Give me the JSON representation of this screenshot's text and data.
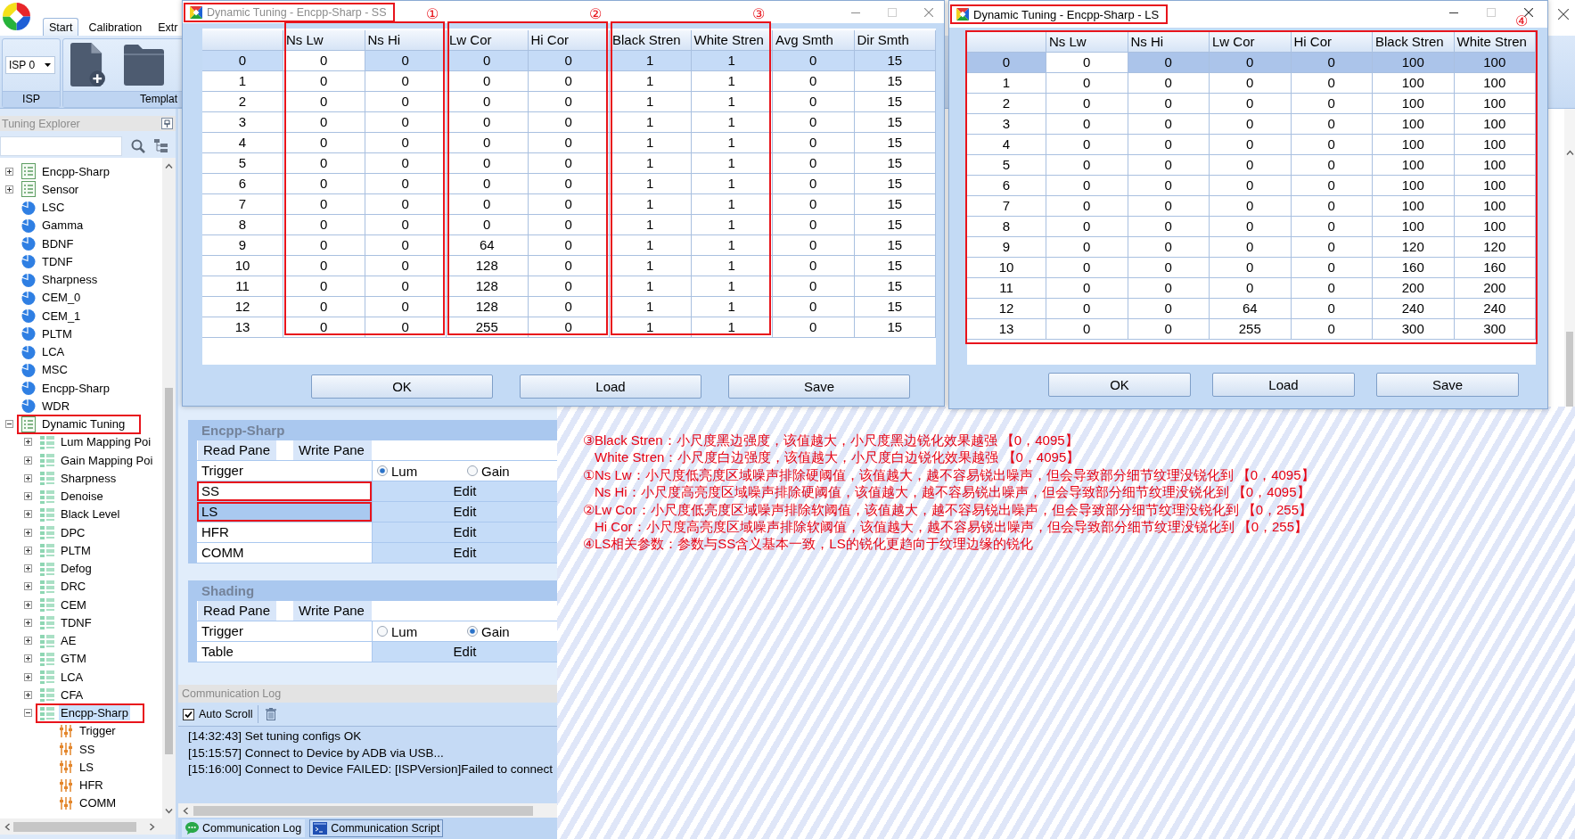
{
  "ribbon": {
    "tabs": [
      {
        "label": "Start",
        "selected": true
      },
      {
        "label": "Calibration",
        "selected": false
      },
      {
        "label": "Extr",
        "selected": false
      }
    ],
    "groups": [
      {
        "kind": "combo",
        "label": "ISP",
        "value": "ISP 0"
      },
      {
        "kind": "templates",
        "label": "Templat"
      }
    ]
  },
  "explorer": {
    "title": "Tuning Explorer",
    "tree": [
      {
        "label": "Encpp-Sharp",
        "kind": "list",
        "expanded": false,
        "selected": false,
        "outlined": false
      },
      {
        "label": "Sensor",
        "kind": "list",
        "expanded": false,
        "selected": false,
        "outlined": false
      },
      {
        "label": "LSC",
        "kind": "module",
        "selected": false,
        "outlined": false
      },
      {
        "label": "Gamma",
        "kind": "module",
        "selected": false,
        "outlined": false
      },
      {
        "label": "BDNF",
        "kind": "module",
        "selected": false,
        "outlined": false
      },
      {
        "label": "TDNF",
        "kind": "module",
        "selected": false,
        "outlined": false
      },
      {
        "label": "Sharpness",
        "kind": "module",
        "selected": false,
        "outlined": false
      },
      {
        "label": "CEM_0",
        "kind": "module",
        "selected": false,
        "outlined": false
      },
      {
        "label": "CEM_1",
        "kind": "module",
        "selected": false,
        "outlined": false
      },
      {
        "label": "PLTM",
        "kind": "module",
        "selected": false,
        "outlined": false
      },
      {
        "label": "LCA",
        "kind": "module",
        "selected": false,
        "outlined": false
      },
      {
        "label": "MSC",
        "kind": "module",
        "selected": false,
        "outlined": false
      },
      {
        "label": "Encpp-Sharp",
        "kind": "module",
        "selected": false,
        "outlined": false
      },
      {
        "label": "WDR",
        "kind": "module",
        "selected": false,
        "outlined": false
      },
      {
        "label": "Dynamic Tuning",
        "kind": "list",
        "expanded": true,
        "selected": false,
        "outlined": true,
        "children": [
          {
            "label": "Lum Mapping Poi",
            "kind": "group",
            "expanded": false,
            "selected": false,
            "outlined": false
          },
          {
            "label": "Gain Mapping Poi",
            "kind": "group",
            "expanded": false,
            "selected": false,
            "outlined": false
          },
          {
            "label": "Sharpness",
            "kind": "group",
            "expanded": false,
            "selected": false,
            "outlined": false
          },
          {
            "label": "Denoise",
            "kind": "group",
            "expanded": false,
            "selected": false,
            "outlined": false
          },
          {
            "label": "Black Level",
            "kind": "group",
            "expanded": false,
            "selected": false,
            "outlined": false
          },
          {
            "label": "DPC",
            "kind": "group",
            "expanded": false,
            "selected": false,
            "outlined": false
          },
          {
            "label": "PLTM",
            "kind": "group",
            "expanded": false,
            "selected": false,
            "outlined": false
          },
          {
            "label": "Defog",
            "kind": "group",
            "expanded": false,
            "selected": false,
            "outlined": false
          },
          {
            "label": "DRC",
            "kind": "group",
            "expanded": false,
            "selected": false,
            "outlined": false
          },
          {
            "label": "CEM",
            "kind": "group",
            "expanded": false,
            "selected": false,
            "outlined": false
          },
          {
            "label": "TDNF",
            "kind": "group",
            "expanded": false,
            "selected": false,
            "outlined": false
          },
          {
            "label": "AE",
            "kind": "group",
            "expanded": false,
            "selected": false,
            "outlined": false
          },
          {
            "label": "GTM",
            "kind": "group",
            "expanded": false,
            "selected": false,
            "outlined": false
          },
          {
            "label": "LCA",
            "kind": "group",
            "expanded": false,
            "selected": false,
            "outlined": false
          },
          {
            "label": "CFA",
            "kind": "group",
            "expanded": false,
            "selected": false,
            "outlined": false
          },
          {
            "label": "Encpp-Sharp",
            "kind": "group",
            "expanded": true,
            "selected": true,
            "outlined": true,
            "children": [
              {
                "label": "Trigger",
                "kind": "param",
                "selected": false,
                "outlined": false
              },
              {
                "label": "SS",
                "kind": "param",
                "selected": false,
                "outlined": false
              },
              {
                "label": "LS",
                "kind": "param",
                "selected": false,
                "outlined": false
              },
              {
                "label": "HFR",
                "kind": "param",
                "selected": false,
                "outlined": false
              },
              {
                "label": "COMM",
                "kind": "param",
                "selected": false,
                "outlined": false
              }
            ]
          }
        ]
      }
    ]
  },
  "dialogs": [
    {
      "title": "Dynamic Tuning - Encpp-Sharp - SS",
      "active": false,
      "title_outlined": true,
      "column_groups": [
        {
          "callout": "①",
          "outlined": true,
          "columns": [
            "Ns Lw",
            "Ns Hi"
          ]
        },
        {
          "callout": "②",
          "outlined": true,
          "columns": [
            "Lw Cor",
            "Hi Cor"
          ]
        },
        {
          "callout": "③",
          "outlined": true,
          "columns": [
            "Black Stren",
            "White Stren"
          ]
        },
        {
          "outlined": false,
          "columns": [
            "Avg Smth",
            "Dir Smth"
          ]
        }
      ],
      "rows": [
        {
          "header": "0",
          "selected": true,
          "current": [
            true,
            false,
            false,
            false,
            false,
            false,
            false,
            false
          ],
          "cells": [
            "0",
            "0",
            "0",
            "0",
            "1",
            "1",
            "0",
            "15"
          ]
        },
        {
          "header": "1",
          "selected": false,
          "cells": [
            "0",
            "0",
            "0",
            "0",
            "1",
            "1",
            "0",
            "15"
          ]
        },
        {
          "header": "2",
          "selected": false,
          "cells": [
            "0",
            "0",
            "0",
            "0",
            "1",
            "1",
            "0",
            "15"
          ]
        },
        {
          "header": "3",
          "selected": false,
          "cells": [
            "0",
            "0",
            "0",
            "0",
            "1",
            "1",
            "0",
            "15"
          ]
        },
        {
          "header": "4",
          "selected": false,
          "cells": [
            "0",
            "0",
            "0",
            "0",
            "1",
            "1",
            "0",
            "15"
          ]
        },
        {
          "header": "5",
          "selected": false,
          "cells": [
            "0",
            "0",
            "0",
            "0",
            "1",
            "1",
            "0",
            "15"
          ]
        },
        {
          "header": "6",
          "selected": false,
          "cells": [
            "0",
            "0",
            "0",
            "0",
            "1",
            "1",
            "0",
            "15"
          ]
        },
        {
          "header": "7",
          "selected": false,
          "cells": [
            "0",
            "0",
            "0",
            "0",
            "1",
            "1",
            "0",
            "15"
          ]
        },
        {
          "header": "8",
          "selected": false,
          "cells": [
            "0",
            "0",
            "0",
            "0",
            "1",
            "1",
            "0",
            "15"
          ]
        },
        {
          "header": "9",
          "selected": false,
          "cells": [
            "0",
            "0",
            "64",
            "0",
            "1",
            "1",
            "0",
            "15"
          ]
        },
        {
          "header": "10",
          "selected": false,
          "cells": [
            "0",
            "0",
            "128",
            "0",
            "1",
            "1",
            "0",
            "15"
          ]
        },
        {
          "header": "11",
          "selected": false,
          "cells": [
            "0",
            "0",
            "128",
            "0",
            "1",
            "1",
            "0",
            "15"
          ]
        },
        {
          "header": "12",
          "selected": false,
          "cells": [
            "0",
            "0",
            "128",
            "0",
            "1",
            "1",
            "0",
            "15"
          ]
        },
        {
          "header": "13",
          "selected": false,
          "cells": [
            "0",
            "0",
            "255",
            "0",
            "1",
            "1",
            "0",
            "15"
          ]
        }
      ],
      "buttons": [
        "OK",
        "Load",
        "Save"
      ]
    },
    {
      "title": "Dynamic Tuning - Encpp-Sharp - LS",
      "active": true,
      "title_outlined": true,
      "table_outlined": true,
      "table_callout": "④",
      "column_groups": [
        {
          "outlined": false,
          "columns": [
            "Ns Lw",
            "Ns Hi",
            "Lw Cor",
            "Hi Cor",
            "Black Stren",
            "White Stren"
          ]
        }
      ],
      "rows": [
        {
          "header": "0",
          "selected": true,
          "current": [
            true,
            false,
            false,
            false,
            false,
            false
          ],
          "cells": [
            "0",
            "0",
            "0",
            "0",
            "100",
            "100"
          ]
        },
        {
          "header": "1",
          "selected": false,
          "cells": [
            "0",
            "0",
            "0",
            "0",
            "100",
            "100"
          ]
        },
        {
          "header": "2",
          "selected": false,
          "cells": [
            "0",
            "0",
            "0",
            "0",
            "100",
            "100"
          ]
        },
        {
          "header": "3",
          "selected": false,
          "cells": [
            "0",
            "0",
            "0",
            "0",
            "100",
            "100"
          ]
        },
        {
          "header": "4",
          "selected": false,
          "cells": [
            "0",
            "0",
            "0",
            "0",
            "100",
            "100"
          ]
        },
        {
          "header": "5",
          "selected": false,
          "cells": [
            "0",
            "0",
            "0",
            "0",
            "100",
            "100"
          ]
        },
        {
          "header": "6",
          "selected": false,
          "cells": [
            "0",
            "0",
            "0",
            "0",
            "100",
            "100"
          ]
        },
        {
          "header": "7",
          "selected": false,
          "cells": [
            "0",
            "0",
            "0",
            "0",
            "100",
            "100"
          ]
        },
        {
          "header": "8",
          "selected": false,
          "cells": [
            "0",
            "0",
            "0",
            "0",
            "100",
            "100"
          ]
        },
        {
          "header": "9",
          "selected": false,
          "cells": [
            "0",
            "0",
            "0",
            "0",
            "120",
            "120"
          ]
        },
        {
          "header": "10",
          "selected": false,
          "cells": [
            "0",
            "0",
            "0",
            "0",
            "160",
            "160"
          ]
        },
        {
          "header": "11",
          "selected": false,
          "cells": [
            "0",
            "0",
            "0",
            "0",
            "200",
            "200"
          ]
        },
        {
          "header": "12",
          "selected": false,
          "cells": [
            "0",
            "0",
            "64",
            "0",
            "240",
            "240"
          ]
        },
        {
          "header": "13",
          "selected": false,
          "cells": [
            "0",
            "0",
            "255",
            "0",
            "300",
            "300"
          ]
        }
      ],
      "buttons": [
        "OK",
        "Load",
        "Save"
      ]
    }
  ],
  "property_groups": [
    {
      "title": "Encpp-Sharp",
      "panes": [
        "Read Pane",
        "Write Pane"
      ],
      "rows": [
        {
          "label": "Trigger",
          "kind": "radio",
          "selected": false,
          "outlined": false,
          "options": [
            {
              "label": "Lum",
              "selected": true
            },
            {
              "label": "Gain",
              "selected": false
            }
          ]
        },
        {
          "label": "SS",
          "kind": "edit",
          "button": "Edit",
          "selected": false,
          "outlined": true
        },
        {
          "label": "LS",
          "kind": "edit",
          "button": "Edit",
          "selected": true,
          "outlined": true
        },
        {
          "label": "HFR",
          "kind": "edit",
          "button": "Edit",
          "selected": false,
          "outlined": false
        },
        {
          "label": "COMM",
          "kind": "edit",
          "button": "Edit",
          "selected": false,
          "outlined": false
        }
      ]
    },
    {
      "title": "Shading",
      "panes": [
        "Read Pane",
        "Write Pane"
      ],
      "rows": [
        {
          "label": "Trigger",
          "kind": "radio",
          "selected": false,
          "outlined": false,
          "options": [
            {
              "label": "Lum",
              "selected": false
            },
            {
              "label": "Gain",
              "selected": true
            }
          ]
        },
        {
          "label": "Table",
          "kind": "edit",
          "button": "Edit",
          "selected": false,
          "outlined": false
        }
      ]
    }
  ],
  "log": {
    "title": "Communication Log",
    "auto_scroll": {
      "label": "Auto Scroll",
      "checked": true
    },
    "lines": [
      "[14:32:43] Set tuning configs OK",
      "[15:15:57] Connect to Device by ADB via USB...",
      "[15:16:00] Connect to Device FAILED: [ISPVersion]Failed to connect"
    ],
    "tabs": [
      {
        "label": "Communication Log",
        "kind": "chat",
        "selected": true
      },
      {
        "label": "Communication Script",
        "kind": "script",
        "selected": false
      }
    ]
  },
  "notes": [
    {
      "text": "③Black Stren：小尺度黑边强度，该值越大，小尺度黑边锐化效果越强 【0，4095】",
      "indented": false
    },
    {
      "text": "White Stren：小尺度白边强度，该值越大，小尺度白边锐化效果越强 【0，4095】",
      "indented": true
    },
    {
      "text": "①Ns Lw：小尺度低亮度区域噪声排除硬阈值，该值越大，越不容易锐出噪声，但会导致部分细节纹理没锐化到 【0，4095】",
      "indented": false
    },
    {
      "text": "Ns Hi：小尺度高亮度区域噪声排除硬阈值，该值越大，越不容易锐出噪声，但会导致部分细节纹理没锐化到 【0，4095】",
      "indented": true
    },
    {
      "text": "②Lw Cor：小尺度低亮度区域噪声排除软阈值，该值越大，越不容易锐出噪声，但会导致部分细节纹理没锐化到 【0，255】",
      "indented": false
    },
    {
      "text": "Hi Cor：小尺度高亮度区域噪声排除软阈值，该值越大，越不容易锐出噪声，但会导致部分细节纹理没锐化到 【0，255】",
      "indented": true
    },
    {
      "text": "④LS相关参数：参数与SS含义基本一致，LS的锐化更趋向于纹理边缘的锐化",
      "indented": false
    }
  ]
}
